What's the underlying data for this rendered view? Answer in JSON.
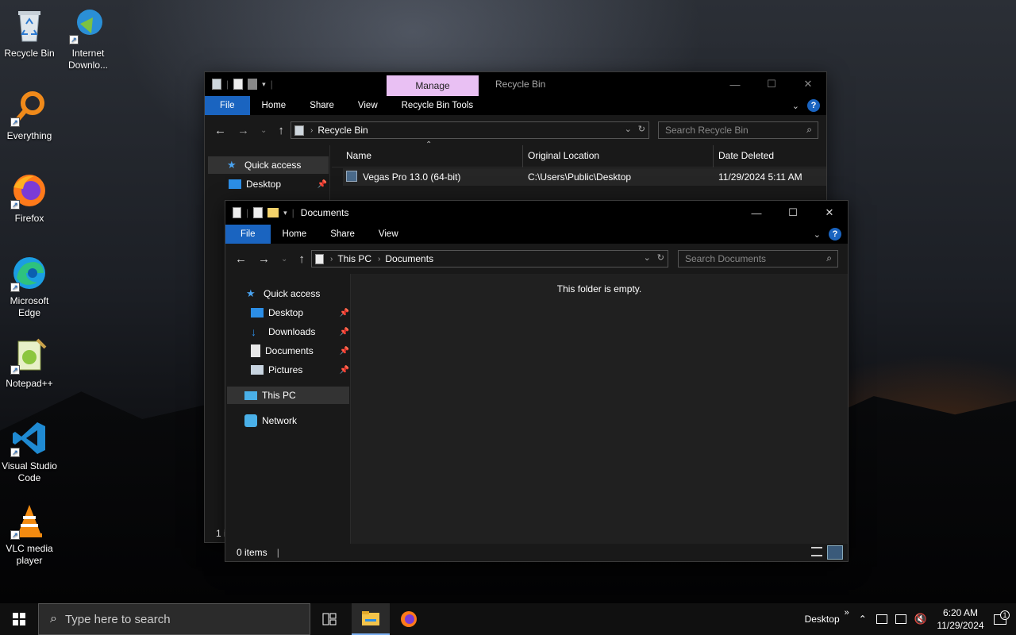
{
  "desktop": {
    "icons": [
      {
        "label": "Recycle Bin",
        "icon": "recycle-bin-icon"
      },
      {
        "label": "Internet Downlo...",
        "icon": "internet-download-manager-icon"
      },
      {
        "label": "Everything",
        "icon": "everything-search-icon"
      },
      {
        "label": "Firefox",
        "icon": "firefox-icon"
      },
      {
        "label": "Microsoft Edge",
        "icon": "edge-icon"
      },
      {
        "label": "Notepad++",
        "icon": "notepadplusplus-icon"
      },
      {
        "label": "Visual Studio Code",
        "icon": "vscode-icon"
      },
      {
        "label": "VLC media player",
        "icon": "vlc-icon"
      }
    ]
  },
  "recycle_window": {
    "context_tab": "Manage",
    "title": "Recycle Bin",
    "tabs": [
      "File",
      "Home",
      "Share",
      "View",
      "Recycle Bin Tools"
    ],
    "breadcrumb": [
      "Recycle Bin"
    ],
    "search_placeholder": "Search Recycle Bin",
    "columns": [
      "Name",
      "Original Location",
      "Date Deleted"
    ],
    "rows": [
      {
        "name": "Vegas Pro 13.0 (64-bit)",
        "location": "C:\\Users\\Public\\Desktop",
        "date": "11/29/2024 5:11 AM"
      }
    ],
    "nav": [
      {
        "label": "Quick access",
        "icon": "star-icon"
      },
      {
        "label": "Desktop",
        "icon": "desktop-folder-icon"
      }
    ],
    "status": "1 i"
  },
  "documents_window": {
    "title": "Documents",
    "tabs": [
      "File",
      "Home",
      "Share",
      "View"
    ],
    "breadcrumb": [
      "This PC",
      "Documents"
    ],
    "search_placeholder": "Search Documents",
    "empty_message": "This folder is empty.",
    "nav": [
      {
        "label": "Quick access",
        "icon": "star-icon"
      },
      {
        "label": "Desktop",
        "icon": "desktop-folder-icon"
      },
      {
        "label": "Downloads",
        "icon": "downloads-folder-icon"
      },
      {
        "label": "Documents",
        "icon": "documents-folder-icon"
      },
      {
        "label": "Pictures",
        "icon": "pictures-folder-icon"
      },
      {
        "label": "This PC",
        "icon": "this-pc-icon"
      },
      {
        "label": "Network",
        "icon": "network-icon"
      }
    ],
    "status": "0 items"
  },
  "taskbar": {
    "search_placeholder": "Type here to search",
    "desktop_label": "Desktop",
    "time": "6:20 AM",
    "date": "11/29/2024",
    "notification_count": "1"
  },
  "colors": {
    "accent": "#1a64c0",
    "manage_tab": "#e9c0f3",
    "window_bg": "#191919"
  }
}
